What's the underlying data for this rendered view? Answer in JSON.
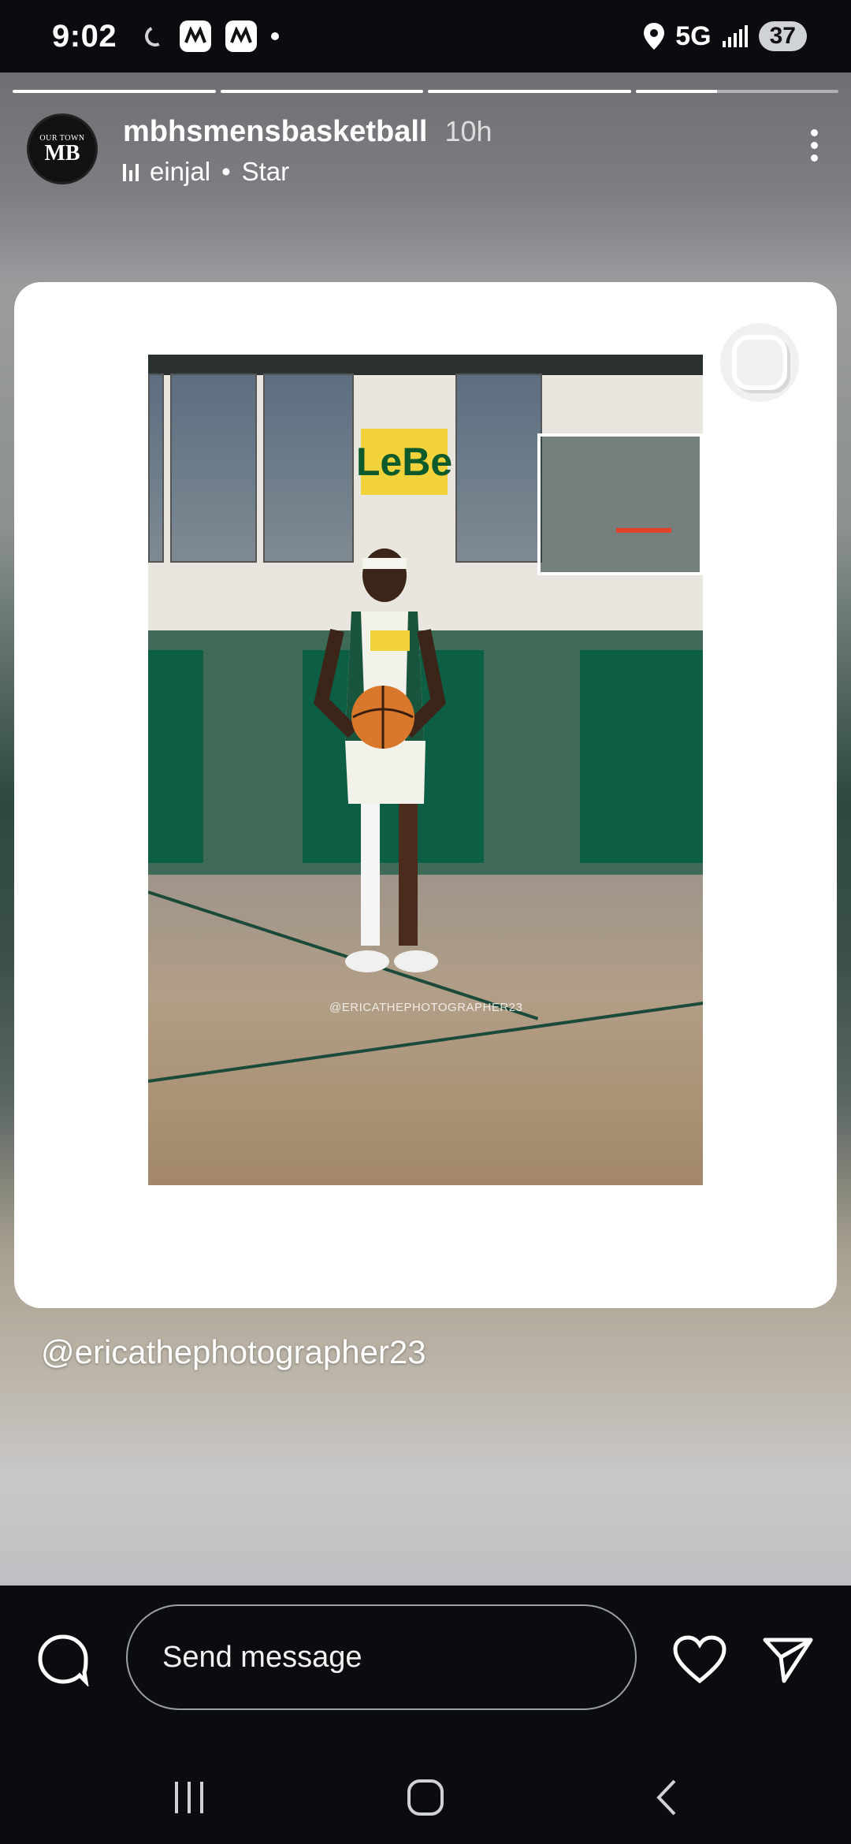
{
  "status_bar": {
    "time": "9:02",
    "network": "5G",
    "battery": "37"
  },
  "story": {
    "progress": [
      1,
      1,
      1,
      0.4
    ],
    "account": {
      "username": "mbhsmensbasketball",
      "time_ago": "10h",
      "avatar_text_top": "OUR TOWN",
      "avatar_text": "MB"
    },
    "music": {
      "artist": "einjal",
      "separator": "•",
      "song": "Star"
    },
    "photo": {
      "wall_text": "LeBe",
      "watermark": "@ERICATHEPHOTOGRAPHER23"
    },
    "caption": "@ericathephotographer23"
  },
  "reply_bar": {
    "placeholder": "Send message",
    "icons": [
      "camera-chat-icon",
      "heart-icon",
      "send-icon"
    ]
  },
  "nav_bar": {
    "icons": [
      "recent-apps-icon",
      "home-icon",
      "back-icon"
    ]
  },
  "colors": {
    "background": "#0b0c10",
    "court_green": "#0c5e45",
    "jersey_yellow": "#f1d23a",
    "basketball": "#d9772a"
  }
}
